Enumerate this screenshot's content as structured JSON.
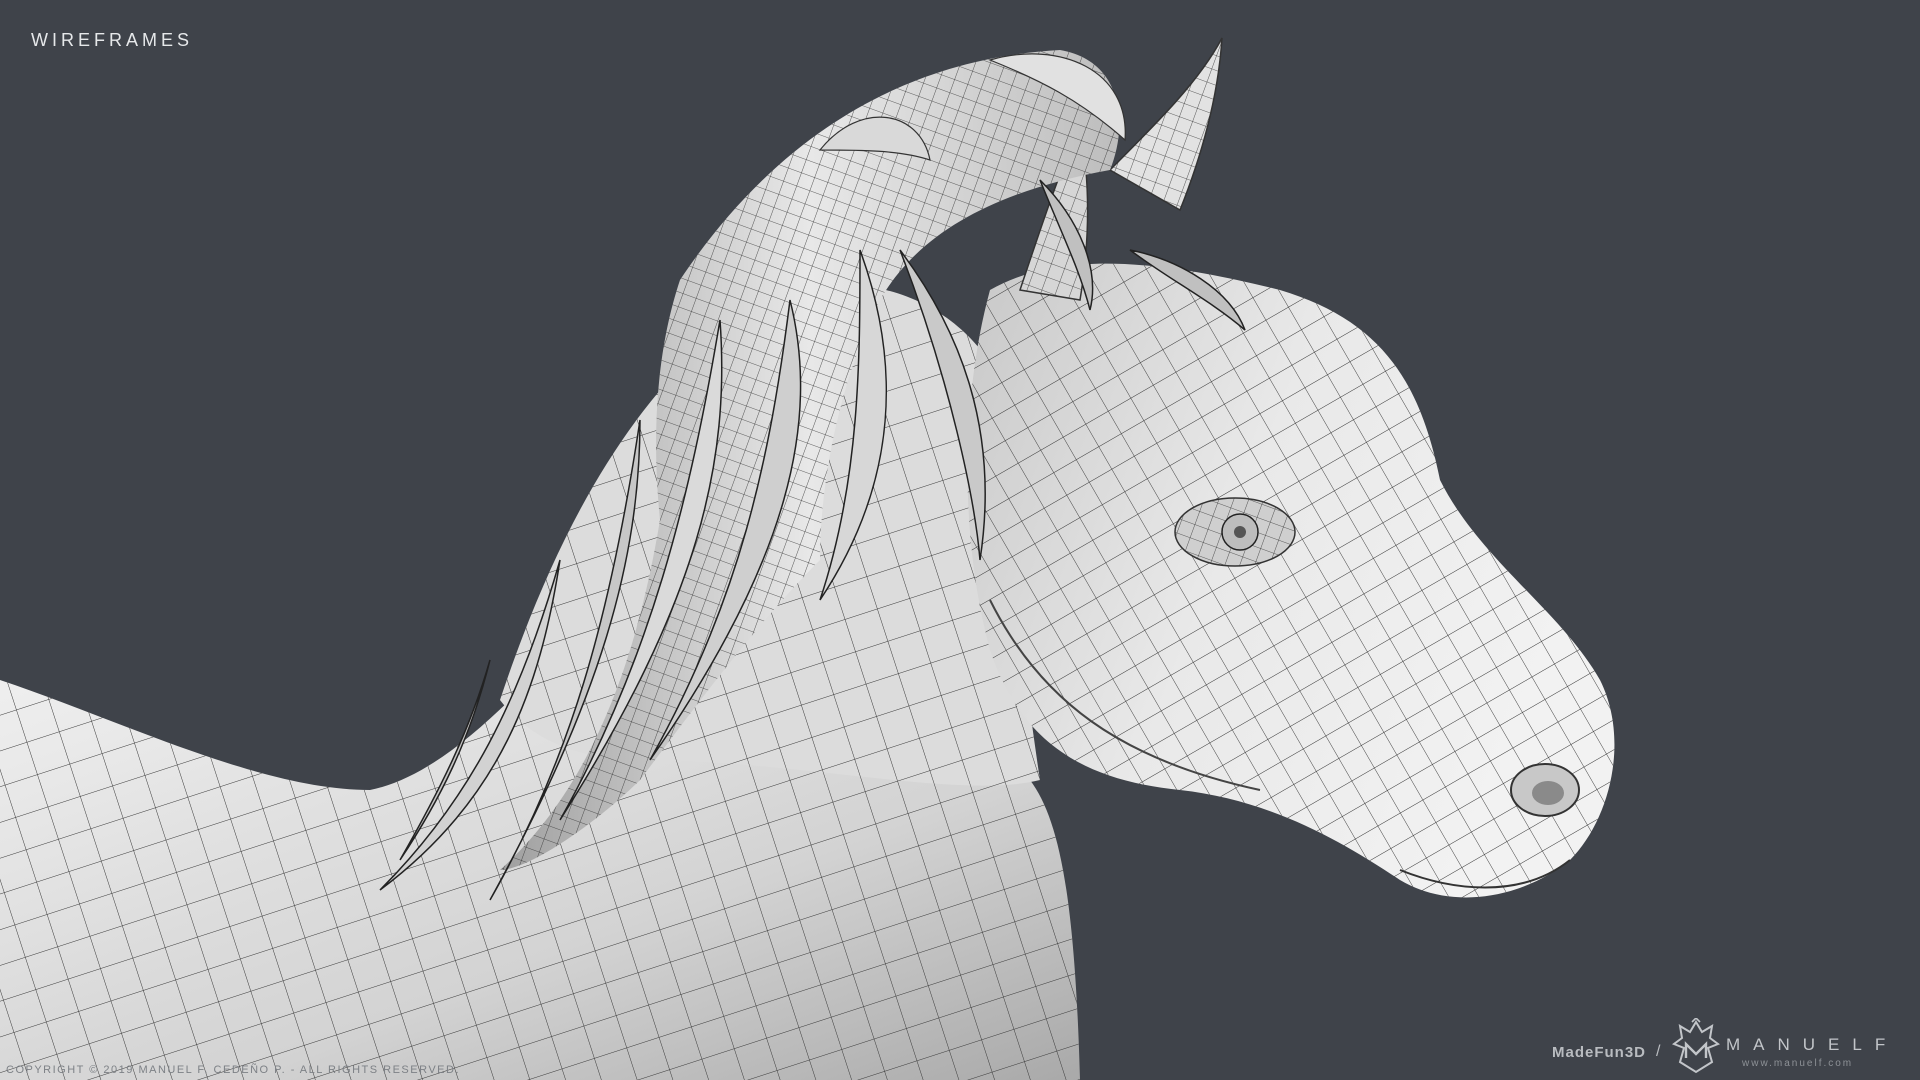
{
  "header": {
    "title": "WIREFRAMES"
  },
  "footer": {
    "copyright": "COPYRIGHT © 2019 MANUEL F. CEDEÑO P. - ALL RIGHTS RESERVED.",
    "brand_madefun": "MadeFun3D",
    "brand_slash": "/",
    "brand_name": "MANUELF",
    "brand_url": "www.manuelf.com"
  },
  "image": {
    "subject": "horse-head-wireframe-render",
    "colors": {
      "background": "#3f434a",
      "model": "#d9d9d9",
      "wire": "#2a2a2a"
    }
  },
  "icons": {
    "logo": "manuelf-logo-icon"
  }
}
